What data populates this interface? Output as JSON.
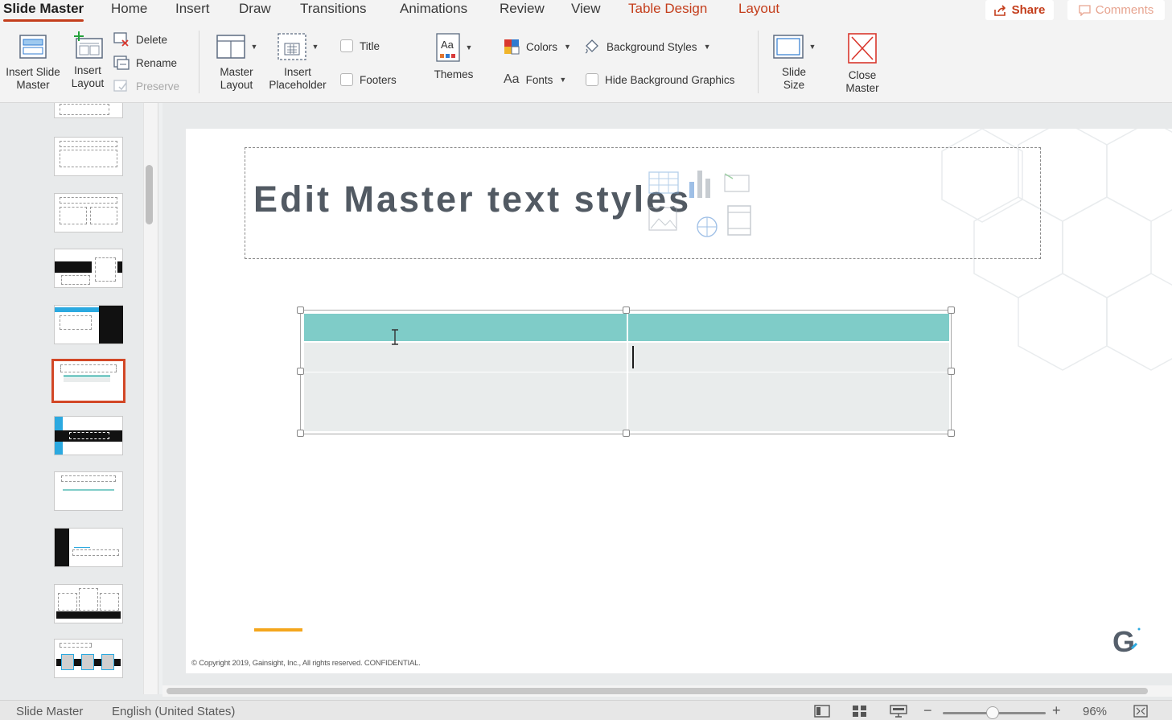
{
  "tabs": [
    {
      "label": "Slide Master",
      "active": true
    },
    {
      "label": "Home"
    },
    {
      "label": "Insert"
    },
    {
      "label": "Draw"
    },
    {
      "label": "Transitions"
    },
    {
      "label": "Animations"
    },
    {
      "label": "Review"
    },
    {
      "label": "View"
    },
    {
      "label": "Table Design",
      "contextual": true
    },
    {
      "label": "Layout",
      "contextual": true
    }
  ],
  "header_actions": {
    "share_label": "Share",
    "comments_label": "Comments"
  },
  "ribbon": {
    "insert_slide_master": "Insert Slide\nMaster",
    "insert_layout": "Insert\nLayout",
    "delete": "Delete",
    "rename": "Rename",
    "preserve": "Preserve",
    "master_layout": "Master\nLayout",
    "insert_placeholder": "Insert\nPlaceholder",
    "title_checkbox": "Title",
    "footers_checkbox": "Footers",
    "themes": "Themes",
    "colors": "Colors",
    "fonts": "Fonts",
    "fonts_glyph": "Aa",
    "background_styles": "Background Styles",
    "hide_background_graphics": "Hide Background Graphics",
    "slide_size": "Slide\nSize",
    "close_master": "Close\nMaster"
  },
  "thumbnails": {
    "count": 11,
    "selected_index": 5
  },
  "slide": {
    "title_text": "Edit Master text styles",
    "copyright": "© Copyright 2019, Gainsight, Inc., All rights reserved. CONFIDENTIAL.",
    "logo_letter": "G",
    "table_header_color": "#7fccc8",
    "accent_orange": "#f4a61c"
  },
  "statusbar": {
    "view_name": "Slide Master",
    "language": "English (United States)",
    "zoom_minus": "−",
    "zoom_plus": "+",
    "zoom_percent": "96%"
  },
  "colors": {
    "accent": "#c43e1c",
    "selected_thumb_border": "#d24726"
  }
}
